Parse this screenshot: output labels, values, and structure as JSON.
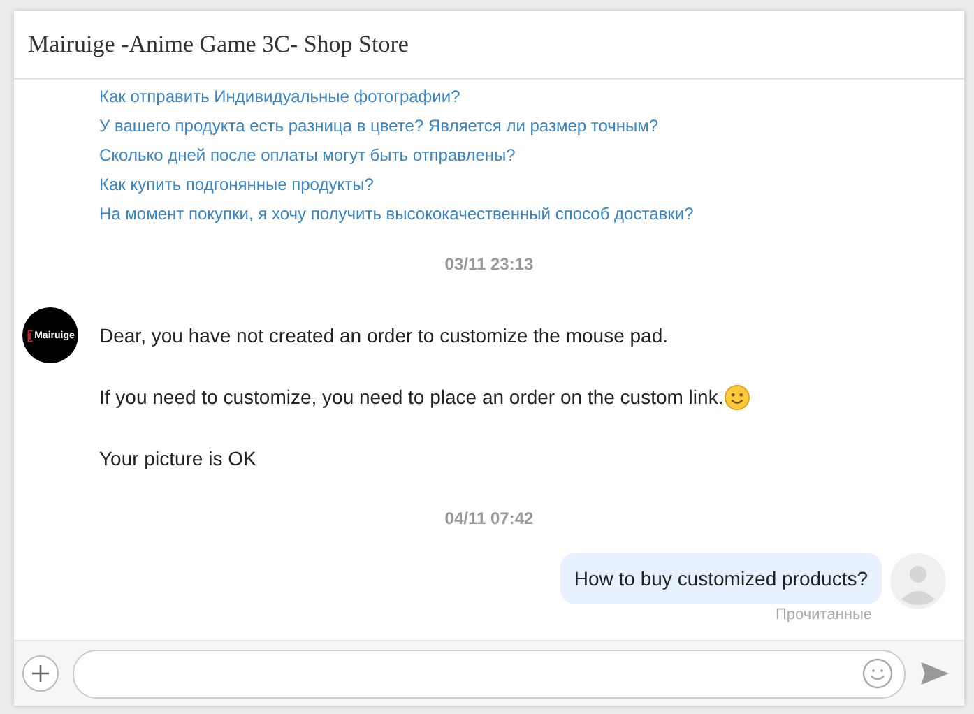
{
  "window": {
    "title": "Mairuige -Anime Game 3C- Shop Store"
  },
  "quick_questions": [
    "Как отправить Индивидуальные фотографии?",
    "У вашего продукта есть разница в цвете? Является ли размер точным?",
    "Сколько дней после оплаты могут быть отправлены?",
    "Как купить подгонянные продукты?",
    "На момент покупки, я хочу получить высококачественный способ доставки?"
  ],
  "thread": [
    {
      "kind": "timestamp",
      "text": "03/11 23:13"
    },
    {
      "kind": "incoming",
      "avatar_label": "Mairuige",
      "lines": [
        {
          "text": "Dear, you have not created an order to customize the mouse pad.",
          "emoji": false
        },
        {
          "text": "If you need to customize, you need to place an order on the custom link.",
          "emoji": true
        },
        {
          "text": "Your picture is OK",
          "emoji": false
        }
      ]
    },
    {
      "kind": "timestamp",
      "text": "04/11 07:42"
    },
    {
      "kind": "outgoing",
      "text": "How to buy customized products?",
      "status": "Прочитанные"
    }
  ]
}
